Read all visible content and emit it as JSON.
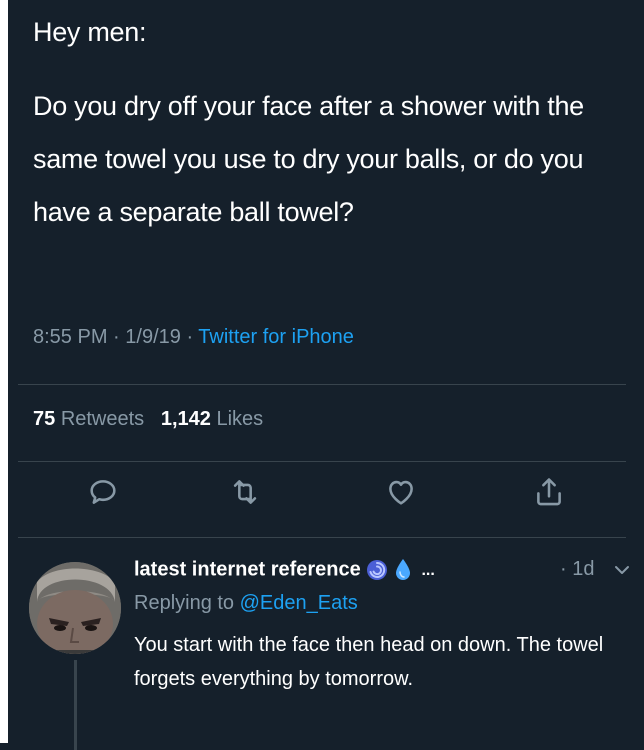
{
  "tweet": {
    "greeting": "Hey men:",
    "body": "Do you dry off your face after a shower with the same towel you use to dry your balls, or do you have a separate ball towel?",
    "time": "8:55 PM",
    "date": "1/9/19",
    "source": "Twitter for iPhone",
    "retweets_count": "75",
    "retweets_label": "Retweets",
    "likes_count": "1,142",
    "likes_label": "Likes"
  },
  "actions": {
    "icons": [
      "reply-icon",
      "retweet-icon",
      "like-icon",
      "share-icon"
    ]
  },
  "reply": {
    "display_name": "latest internet reference",
    "name_emojis": [
      "cyclone",
      "droplet"
    ],
    "ellipsis": "...",
    "time": "· 1d",
    "replying_label": "Replying to",
    "replying_handle": "@Eden_Eats",
    "text": "You start with the face then head on down. The towel forgets everything by tomorrow."
  },
  "colors": {
    "background": "#15202b",
    "secondary_text": "#8899a6",
    "link": "#1da1f2",
    "divider": "#38444d"
  }
}
